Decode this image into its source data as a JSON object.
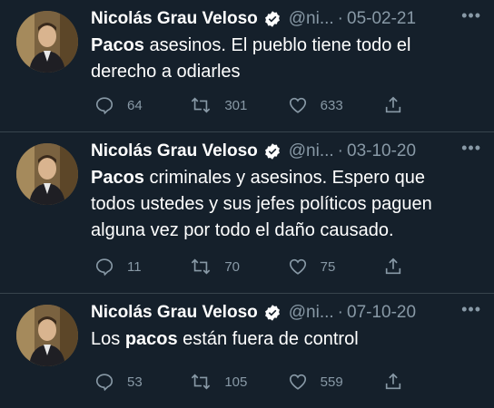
{
  "tweets": [
    {
      "author": "Nicolás Grau Veloso",
      "handle": "@ni...",
      "date": "05-02-21",
      "separator": "·",
      "text_bold": "Pacos",
      "text_before": "",
      "text_after": " asesinos. El pueblo tiene todo el derecho a odiarles",
      "replies": "64",
      "retweets": "301",
      "likes": "633"
    },
    {
      "author": "Nicolás Grau Veloso",
      "handle": "@ni...",
      "date": "03-10-20",
      "separator": "·",
      "text_bold": "Pacos",
      "text_before": "",
      "text_after": " criminales y asesinos. Espero que todos ustedes y sus jefes políticos paguen alguna vez por todo el daño causado.",
      "replies": "11",
      "retweets": "70",
      "likes": "75"
    },
    {
      "author": "Nicolás Grau Veloso",
      "handle": "@ni...",
      "date": "07-10-20",
      "separator": "·",
      "text_bold": "pacos",
      "text_before": "Los ",
      "text_after": " están fuera de control",
      "replies": "53",
      "retweets": "105",
      "likes": "559"
    }
  ],
  "icons": {
    "verified": "verified-badge-icon",
    "more": "more-horizontal-icon",
    "reply": "reply-icon",
    "retweet": "retweet-icon",
    "like": "heart-icon",
    "share": "share-icon"
  },
  "colors": {
    "background": "#15202b",
    "secondary_text": "#8899a6",
    "divider": "#38444d"
  }
}
